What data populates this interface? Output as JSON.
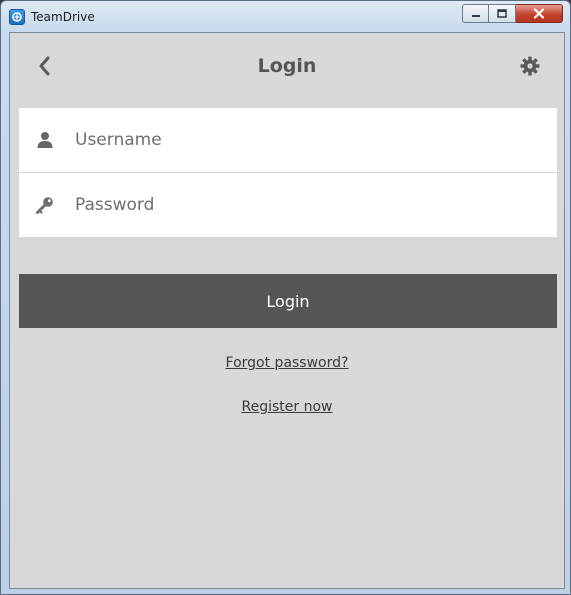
{
  "window": {
    "title": "TeamDrive"
  },
  "header": {
    "title": "Login"
  },
  "form": {
    "username_placeholder": "Username",
    "username_value": "",
    "password_placeholder": "Password",
    "password_value": ""
  },
  "actions": {
    "login_label": "Login",
    "forgot_label": "Forgot password?",
    "register_label": "Register now"
  },
  "icons": {
    "back": "chevron-left-icon",
    "settings": "gear-icon",
    "username": "user-icon",
    "password": "key-icon",
    "app": "teamdrive-logo-icon"
  },
  "colors": {
    "background": "#d8d8d8",
    "primary_button": "#555555",
    "title_text": "#555555"
  }
}
